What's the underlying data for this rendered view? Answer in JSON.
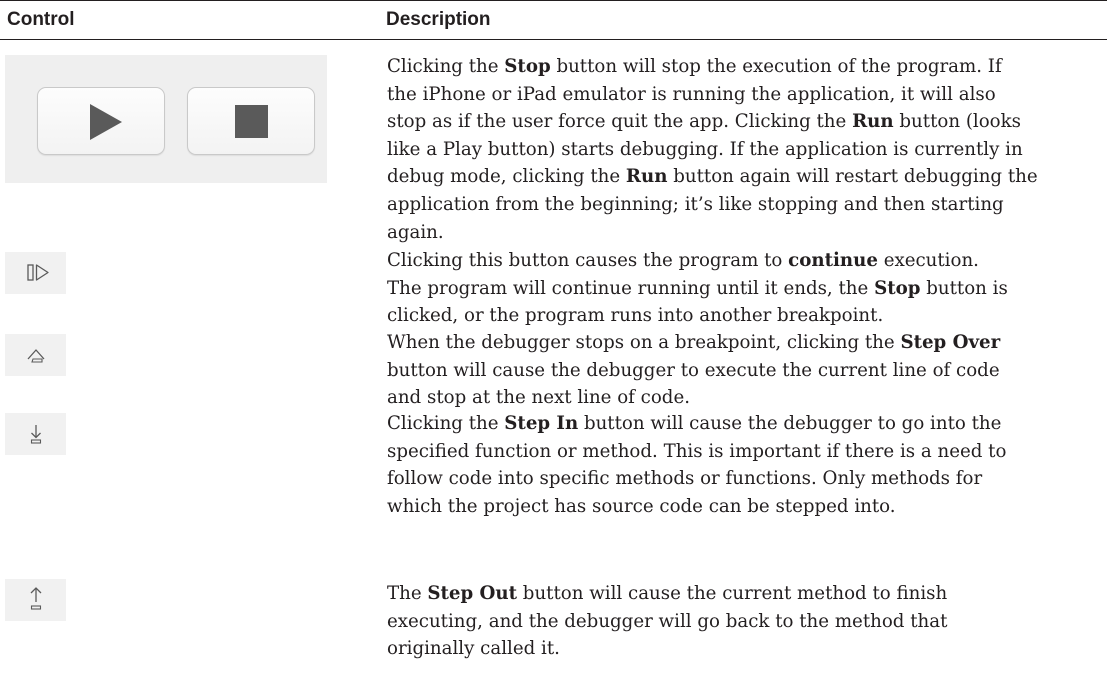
{
  "header": {
    "control": "Control",
    "description": "Description"
  },
  "rows": [
    {
      "control_icons": [
        "play-icon",
        "stop-icon"
      ],
      "parts": [
        "Clicking the ",
        "Stop",
        " button will stop the execution of the program. If\nthe iPhone or iPad emulator is running the application, it will also\nstop as if the user force quit the app. Clicking the ",
        "Run",
        " button (looks\nlike a Play button) starts debugging. If the application is currently in\ndebug mode, clicking the ",
        "Run",
        " button again will restart debugging the\napplication from the beginning; it’s like stopping and then starting\nagain."
      ]
    },
    {
      "control_icons": [
        "continue-icon"
      ],
      "parts": [
        "Clicking this button causes the program to ",
        "continue",
        " execution.\nThe program will continue running until it ends, the ",
        "Stop",
        " button is\nclicked, or the program runs into another breakpoint."
      ]
    },
    {
      "control_icons": [
        "step-over-icon"
      ],
      "parts": [
        "When the debugger stops on a breakpoint, clicking the ",
        "Step Over",
        "\nbutton will cause the debugger to execute the current line of code\nand stop at the next line of code."
      ]
    },
    {
      "control_icons": [
        "step-in-icon"
      ],
      "parts": [
        "Clicking the ",
        "Step In",
        " button will cause the debugger to go into the\nspecified function or method. This is important if there is a need to\nfollow code into specific methods or functions. Only methods for\nwhich the project has source code can be stepped into."
      ]
    },
    {
      "control_icons": [
        "step-out-icon"
      ],
      "parts": [
        "The ",
        "Step Out",
        " button will cause the current method to finish\nexecuting, and the debugger will go back to the method that\noriginally called it."
      ]
    }
  ],
  "colors": {
    "text": "#231f20",
    "icon": "#5a5a5a",
    "panel": "#efefef"
  }
}
